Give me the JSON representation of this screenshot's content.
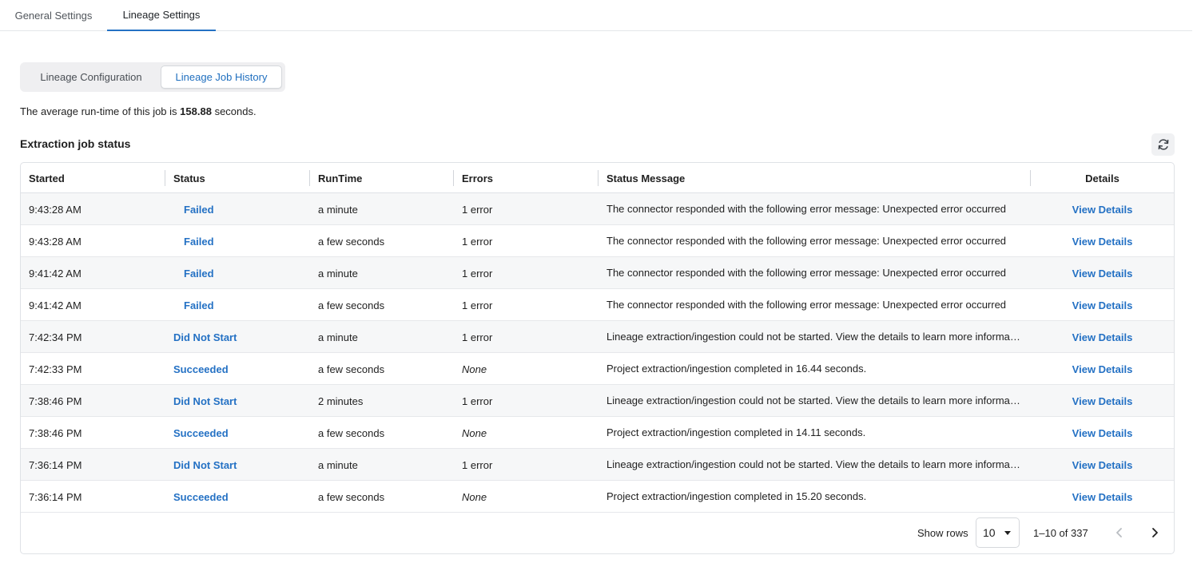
{
  "top_tabs": [
    {
      "label": "General Settings"
    },
    {
      "label": "Lineage Settings"
    }
  ],
  "segmented": {
    "config_label": "Lineage Configuration",
    "history_label": "Lineage Job History"
  },
  "average": {
    "prefix": "The average run-time of this job is",
    "value": "158.88",
    "suffix": "seconds."
  },
  "section_title": "Extraction job status",
  "refresh_icon": "refresh-icon",
  "table": {
    "columns": [
      "Started",
      "Status",
      "RunTime",
      "Errors",
      "Status Message",
      "Details"
    ],
    "rows": [
      {
        "started": "9:43:28 AM",
        "status": "Failed",
        "runtime": "a minute",
        "errors": "1 error",
        "message": "The connector responded with the following error message: Unexpected error occurred",
        "details": "View Details"
      },
      {
        "started": "9:43:28 AM",
        "status": "Failed",
        "runtime": "a few seconds",
        "errors": "1 error",
        "message": "The connector responded with the following error message: Unexpected error occurred",
        "details": "View Details"
      },
      {
        "started": "9:41:42 AM",
        "status": "Failed",
        "runtime": "a minute",
        "errors": "1 error",
        "message": "The connector responded with the following error message: Unexpected error occurred",
        "details": "View Details"
      },
      {
        "started": "9:41:42 AM",
        "status": "Failed",
        "runtime": "a few seconds",
        "errors": "1 error",
        "message": "The connector responded with the following error message: Unexpected error occurred",
        "details": "View Details"
      },
      {
        "started": "7:42:34 PM",
        "status": "Did Not Start",
        "runtime": "a minute",
        "errors": "1 error",
        "message": "Lineage extraction/ingestion could not be started. View the details to learn more information",
        "details": "View Details"
      },
      {
        "started": "7:42:33 PM",
        "status": "Succeeded",
        "runtime": "a few seconds",
        "errors": "None",
        "message": "Project extraction/ingestion completed in 16.44 seconds.",
        "details": "View Details"
      },
      {
        "started": "7:38:46 PM",
        "status": "Did Not Start",
        "runtime": "2 minutes",
        "errors": "1 error",
        "message": "Lineage extraction/ingestion could not be started. View the details to learn more information",
        "details": "View Details"
      },
      {
        "started": "7:38:46 PM",
        "status": "Succeeded",
        "runtime": "a few seconds",
        "errors": "None",
        "message": "Project extraction/ingestion completed in 14.11 seconds.",
        "details": "View Details"
      },
      {
        "started": "7:36:14 PM",
        "status": "Did Not Start",
        "runtime": "a minute",
        "errors": "1 error",
        "message": "Lineage extraction/ingestion could not be started. View the details to learn more information",
        "details": "View Details"
      },
      {
        "started": "7:36:14 PM",
        "status": "Succeeded",
        "runtime": "a few seconds",
        "errors": "None",
        "message": "Project extraction/ingestion completed in 15.20 seconds.",
        "details": "View Details"
      }
    ]
  },
  "footer": {
    "show_rows_label": "Show rows",
    "rows_value": "10",
    "range": "1–10 of 337",
    "prev_icon": "chevron-left-icon",
    "next_icon": "chevron-right-icon"
  },
  "colors": {
    "accent": "#2471c4",
    "border": "#dfe2e6",
    "stripe": "#f6f7f8"
  }
}
